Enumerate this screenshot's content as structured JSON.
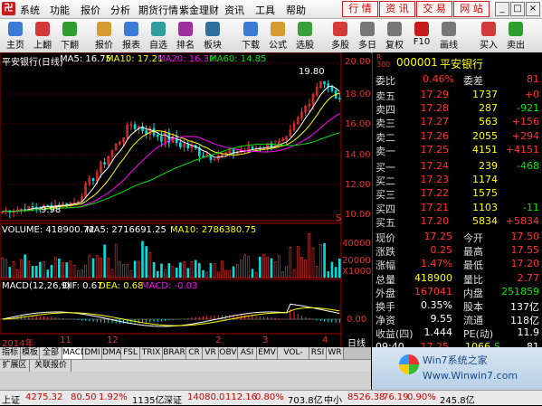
{
  "menubar": {
    "items": [
      "系统",
      "功能",
      "报价",
      "分析",
      "期货行情",
      "紫金理财",
      "资讯",
      "工具",
      "帮助"
    ],
    "right_tabs": [
      "行 情",
      "资 讯",
      "交 易",
      "网 站"
    ]
  },
  "toolbar": {
    "buttons": [
      {
        "label": "主页",
        "icon": "home-icon",
        "color": "#3a7bd5"
      },
      {
        "label": "上翻",
        "icon": "up-arrow-icon",
        "color": "#d53a3a"
      },
      {
        "label": "下翻",
        "icon": "down-arrow-icon",
        "color": "#2f9e2f"
      },
      {
        "label": "报价",
        "icon": "quote-icon",
        "color": "#d59b2f"
      },
      {
        "label": "报表",
        "icon": "report-icon",
        "color": "#3a7bd5"
      },
      {
        "label": "自选",
        "icon": "favorite-icon",
        "color": "#2f9e9e"
      },
      {
        "label": "排名",
        "icon": "ranking-icon",
        "color": "#9e2f9e"
      },
      {
        "label": "板块",
        "icon": "sector-icon",
        "color": "#2f6f9e"
      },
      {
        "label": "下载",
        "icon": "download-icon",
        "color": "#3a7bd5"
      },
      {
        "label": "公式",
        "icon": "formula-icon",
        "color": "#d59b2f"
      },
      {
        "label": "选股",
        "icon": "stock-pick-icon",
        "color": "#3a9e3a"
      },
      {
        "label": "多股",
        "icon": "multi-stock-icon",
        "color": "#d53a3a"
      },
      {
        "label": "多日",
        "icon": "multi-day-icon",
        "color": "#777777"
      },
      {
        "label": "复权",
        "icon": "adjust-icon",
        "color": "#777777"
      },
      {
        "label": "F10",
        "icon": "f10-icon",
        "color": "#c71c1c"
      },
      {
        "label": "画线",
        "icon": "draw-line-icon",
        "color": "#777777"
      },
      {
        "label": "买入",
        "icon": "buy-icon",
        "color": "#d53a3a"
      },
      {
        "label": "卖出",
        "icon": "sell-icon",
        "color": "#2f9e2f"
      }
    ]
  },
  "chart_header": {
    "title": "平安银行(日线)",
    "ma5": "MA5: 16.75",
    "ma10": "MA10: 17.21",
    "ma20": "MA20: 16.32",
    "ma60": "MA60: 14.85"
  },
  "volume_header": {
    "volume": "VOLUME: 418900.72",
    "ma5": "MA5: 2716691.25",
    "ma10": "MA10: 2786380.75"
  },
  "macd_header": {
    "label": "MACD(12,26,9)",
    "dif": "DIF: 0.67",
    "dea": "DEA: 0.68",
    "macd": "MACD: -0.03"
  },
  "annotations": {
    "high": "19.80",
    "low": "9.98",
    "marker": "S"
  },
  "axis_labels": {
    "price": [
      "20.00",
      "18.00",
      "16.00",
      "14.00",
      "12.00",
      "10.00"
    ],
    "volume": [
      "40000",
      "20000",
      "X1000"
    ],
    "macd": [
      "0.00"
    ],
    "time": [
      "2014年",
      "11",
      "12",
      "2",
      "3",
      "4"
    ],
    "period": "日线"
  },
  "quote": {
    "code_label": "R 300",
    "code": "000001",
    "name": "平安银行",
    "weibi_label": "委比",
    "weibi": "0.46%",
    "weicha_label": "委差",
    "weicha": "81",
    "asks": [
      {
        "label": "卖五",
        "price": "17.29",
        "vol": "1737",
        "chg": "+0"
      },
      {
        "label": "卖四",
        "price": "17.28",
        "vol": "287",
        "chg": "-921"
      },
      {
        "label": "卖三",
        "price": "17.27",
        "vol": "563",
        "chg": "+156"
      },
      {
        "label": "卖二",
        "price": "17.26",
        "vol": "2055",
        "chg": "+294"
      },
      {
        "label": "卖一",
        "price": "17.25",
        "vol": "4151",
        "chg": "+4151"
      }
    ],
    "bids": [
      {
        "label": "买一",
        "price": "17.24",
        "vol": "239",
        "chg": "-468"
      },
      {
        "label": "买二",
        "price": "17.23",
        "vol": "1174",
        "chg": ""
      },
      {
        "label": "买三",
        "price": "17.22",
        "vol": "1575",
        "chg": ""
      },
      {
        "label": "买四",
        "price": "17.21",
        "vol": "1103",
        "chg": "-11"
      },
      {
        "label": "买五",
        "price": "17.20",
        "vol": "5834",
        "chg": "+5834"
      }
    ],
    "stats": [
      {
        "l1": "现价",
        "v1": "17.25",
        "l2": "今开",
        "v2": "17.50"
      },
      {
        "l1": "涨跌",
        "v1": "0.25",
        "l2": "最高",
        "v2": "17.55"
      },
      {
        "l1": "涨幅",
        "v1": "1.47%",
        "l2": "最低",
        "v2": "17.20"
      },
      {
        "l1": "总量",
        "v1": "418900",
        "l2": "量比",
        "v2": "2.77"
      },
      {
        "l1": "外盘",
        "v1": "167041",
        "l2": "内盘",
        "v2": "251859"
      },
      {
        "l1": "换手",
        "v1": "0.35%",
        "l2": "股本",
        "v2": "137亿"
      },
      {
        "l1": "净资",
        "v1": "9.55",
        "l2": "流通",
        "v2": "118亿"
      },
      {
        "l1": "收益(四)",
        "v1": "1.444",
        "l2": "PE(动)",
        "v2": "11.9"
      }
    ],
    "tick": {
      "time": "09:40",
      "price": "17.25",
      "vol": "1066",
      "side": "S",
      "extra": "81"
    }
  },
  "tabs1": [
    "指标",
    "模板",
    "全部",
    "MACD",
    "DMI",
    "DMA",
    "FSL",
    "TRIX",
    "BRAR",
    "CR",
    "VR",
    "OBV",
    "ASI",
    "EMV",
    "VOL-TDX",
    "RSI",
    "WR"
  ],
  "tabs2": [
    "扩展区",
    "关联报价"
  ],
  "status": {
    "sh_label": "上证",
    "sh_val": "4275.32",
    "sh_chg": "80.50",
    "sh_pct": "1.92%",
    "sh_amt": "1135亿",
    "sz_label": "深证",
    "sz_val": "14080.0",
    "sz_chg": "112.16",
    "sz_pct": "0.80%",
    "sz_amt": "703.8亿",
    "zx_label": "中小",
    "zx_val": "8526.38",
    "zx_chg": "76.19",
    "zx_pct": "0.90%",
    "zx_amt": "245.8亿"
  },
  "watermark": "Win7系统之家 Www.Winwin7.com",
  "colors": {
    "up": "#ff3232",
    "down": "#00e600",
    "ma5": "#ffffff",
    "ma10": "#ffff00",
    "ma20": "#ff00ff",
    "ma60": "#00e600"
  }
}
